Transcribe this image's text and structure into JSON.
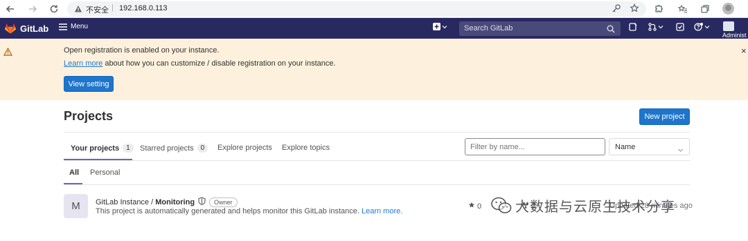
{
  "browser": {
    "security_label": "不安全",
    "separator": "|",
    "url": "192.168.0.113"
  },
  "navbar": {
    "brand": "GitLab",
    "menu_label": "Menu",
    "search_placeholder": "Search GitLab",
    "user_label": "Administ"
  },
  "banner": {
    "title": "Open registration is enabled on your instance.",
    "link": "Learn more",
    "text": " about how you can customize / disable registration on your instance.",
    "button": "View setting",
    "close": "×"
  },
  "page": {
    "title": "Projects",
    "new_project": "New project"
  },
  "tabs": [
    {
      "label": "Your projects",
      "count": "1"
    },
    {
      "label": "Starred projects",
      "count": "0"
    },
    {
      "label": "Explore projects"
    },
    {
      "label": "Explore topics"
    }
  ],
  "filter": {
    "placeholder": "Filter by name...",
    "sort_value": "Name"
  },
  "subtabs": [
    {
      "label": "All"
    },
    {
      "label": "Personal"
    }
  ],
  "projects": [
    {
      "avatar_letter": "M",
      "namespace": "GitLab Instance / ",
      "name": "Monitoring",
      "role": "Owner",
      "description": "This project is automatically generated and helps monitor this GitLab instance. ",
      "description_link": "Learn more.",
      "stars": "0",
      "forks": "0",
      "updated": "Updated 28 minutes ago"
    }
  ],
  "watermark": {
    "text": "大数据与云原生技术分享"
  },
  "colors": {
    "navbar_bg": "#292961",
    "banner_bg": "#fdf1dd",
    "primary": "#1f75cb",
    "tab_accent": "#6666c4"
  }
}
